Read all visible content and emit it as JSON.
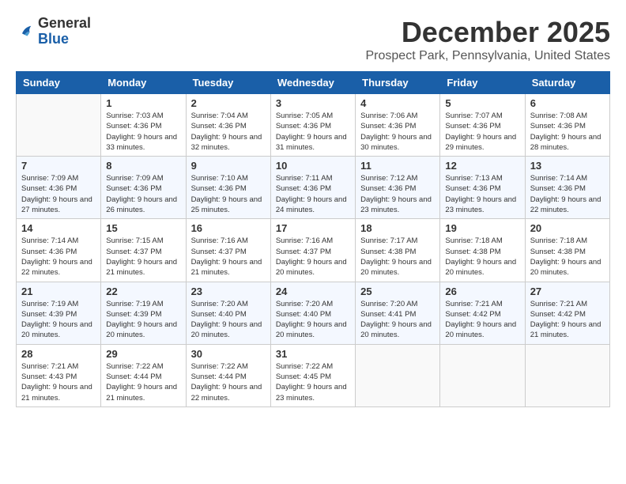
{
  "header": {
    "logo_general": "General",
    "logo_blue": "Blue",
    "month_title": "December 2025",
    "location": "Prospect Park, Pennsylvania, United States"
  },
  "days_of_week": [
    "Sunday",
    "Monday",
    "Tuesday",
    "Wednesday",
    "Thursday",
    "Friday",
    "Saturday"
  ],
  "weeks": [
    [
      {
        "day": "",
        "sunrise": "",
        "sunset": "",
        "daylight": ""
      },
      {
        "day": "1",
        "sunrise": "Sunrise: 7:03 AM",
        "sunset": "Sunset: 4:36 PM",
        "daylight": "Daylight: 9 hours and 33 minutes."
      },
      {
        "day": "2",
        "sunrise": "Sunrise: 7:04 AM",
        "sunset": "Sunset: 4:36 PM",
        "daylight": "Daylight: 9 hours and 32 minutes."
      },
      {
        "day": "3",
        "sunrise": "Sunrise: 7:05 AM",
        "sunset": "Sunset: 4:36 PM",
        "daylight": "Daylight: 9 hours and 31 minutes."
      },
      {
        "day": "4",
        "sunrise": "Sunrise: 7:06 AM",
        "sunset": "Sunset: 4:36 PM",
        "daylight": "Daylight: 9 hours and 30 minutes."
      },
      {
        "day": "5",
        "sunrise": "Sunrise: 7:07 AM",
        "sunset": "Sunset: 4:36 PM",
        "daylight": "Daylight: 9 hours and 29 minutes."
      },
      {
        "day": "6",
        "sunrise": "Sunrise: 7:08 AM",
        "sunset": "Sunset: 4:36 PM",
        "daylight": "Daylight: 9 hours and 28 minutes."
      }
    ],
    [
      {
        "day": "7",
        "sunrise": "Sunrise: 7:09 AM",
        "sunset": "Sunset: 4:36 PM",
        "daylight": "Daylight: 9 hours and 27 minutes."
      },
      {
        "day": "8",
        "sunrise": "Sunrise: 7:09 AM",
        "sunset": "Sunset: 4:36 PM",
        "daylight": "Daylight: 9 hours and 26 minutes."
      },
      {
        "day": "9",
        "sunrise": "Sunrise: 7:10 AM",
        "sunset": "Sunset: 4:36 PM",
        "daylight": "Daylight: 9 hours and 25 minutes."
      },
      {
        "day": "10",
        "sunrise": "Sunrise: 7:11 AM",
        "sunset": "Sunset: 4:36 PM",
        "daylight": "Daylight: 9 hours and 24 minutes."
      },
      {
        "day": "11",
        "sunrise": "Sunrise: 7:12 AM",
        "sunset": "Sunset: 4:36 PM",
        "daylight": "Daylight: 9 hours and 23 minutes."
      },
      {
        "day": "12",
        "sunrise": "Sunrise: 7:13 AM",
        "sunset": "Sunset: 4:36 PM",
        "daylight": "Daylight: 9 hours and 23 minutes."
      },
      {
        "day": "13",
        "sunrise": "Sunrise: 7:14 AM",
        "sunset": "Sunset: 4:36 PM",
        "daylight": "Daylight: 9 hours and 22 minutes."
      }
    ],
    [
      {
        "day": "14",
        "sunrise": "Sunrise: 7:14 AM",
        "sunset": "Sunset: 4:36 PM",
        "daylight": "Daylight: 9 hours and 22 minutes."
      },
      {
        "day": "15",
        "sunrise": "Sunrise: 7:15 AM",
        "sunset": "Sunset: 4:37 PM",
        "daylight": "Daylight: 9 hours and 21 minutes."
      },
      {
        "day": "16",
        "sunrise": "Sunrise: 7:16 AM",
        "sunset": "Sunset: 4:37 PM",
        "daylight": "Daylight: 9 hours and 21 minutes."
      },
      {
        "day": "17",
        "sunrise": "Sunrise: 7:16 AM",
        "sunset": "Sunset: 4:37 PM",
        "daylight": "Daylight: 9 hours and 20 minutes."
      },
      {
        "day": "18",
        "sunrise": "Sunrise: 7:17 AM",
        "sunset": "Sunset: 4:38 PM",
        "daylight": "Daylight: 9 hours and 20 minutes."
      },
      {
        "day": "19",
        "sunrise": "Sunrise: 7:18 AM",
        "sunset": "Sunset: 4:38 PM",
        "daylight": "Daylight: 9 hours and 20 minutes."
      },
      {
        "day": "20",
        "sunrise": "Sunrise: 7:18 AM",
        "sunset": "Sunset: 4:38 PM",
        "daylight": "Daylight: 9 hours and 20 minutes."
      }
    ],
    [
      {
        "day": "21",
        "sunrise": "Sunrise: 7:19 AM",
        "sunset": "Sunset: 4:39 PM",
        "daylight": "Daylight: 9 hours and 20 minutes."
      },
      {
        "day": "22",
        "sunrise": "Sunrise: 7:19 AM",
        "sunset": "Sunset: 4:39 PM",
        "daylight": "Daylight: 9 hours and 20 minutes."
      },
      {
        "day": "23",
        "sunrise": "Sunrise: 7:20 AM",
        "sunset": "Sunset: 4:40 PM",
        "daylight": "Daylight: 9 hours and 20 minutes."
      },
      {
        "day": "24",
        "sunrise": "Sunrise: 7:20 AM",
        "sunset": "Sunset: 4:40 PM",
        "daylight": "Daylight: 9 hours and 20 minutes."
      },
      {
        "day": "25",
        "sunrise": "Sunrise: 7:20 AM",
        "sunset": "Sunset: 4:41 PM",
        "daylight": "Daylight: 9 hours and 20 minutes."
      },
      {
        "day": "26",
        "sunrise": "Sunrise: 7:21 AM",
        "sunset": "Sunset: 4:42 PM",
        "daylight": "Daylight: 9 hours and 20 minutes."
      },
      {
        "day": "27",
        "sunrise": "Sunrise: 7:21 AM",
        "sunset": "Sunset: 4:42 PM",
        "daylight": "Daylight: 9 hours and 21 minutes."
      }
    ],
    [
      {
        "day": "28",
        "sunrise": "Sunrise: 7:21 AM",
        "sunset": "Sunset: 4:43 PM",
        "daylight": "Daylight: 9 hours and 21 minutes."
      },
      {
        "day": "29",
        "sunrise": "Sunrise: 7:22 AM",
        "sunset": "Sunset: 4:44 PM",
        "daylight": "Daylight: 9 hours and 21 minutes."
      },
      {
        "day": "30",
        "sunrise": "Sunrise: 7:22 AM",
        "sunset": "Sunset: 4:44 PM",
        "daylight": "Daylight: 9 hours and 22 minutes."
      },
      {
        "day": "31",
        "sunrise": "Sunrise: 7:22 AM",
        "sunset": "Sunset: 4:45 PM",
        "daylight": "Daylight: 9 hours and 23 minutes."
      },
      {
        "day": "",
        "sunrise": "",
        "sunset": "",
        "daylight": ""
      },
      {
        "day": "",
        "sunrise": "",
        "sunset": "",
        "daylight": ""
      },
      {
        "day": "",
        "sunrise": "",
        "sunset": "",
        "daylight": ""
      }
    ]
  ]
}
